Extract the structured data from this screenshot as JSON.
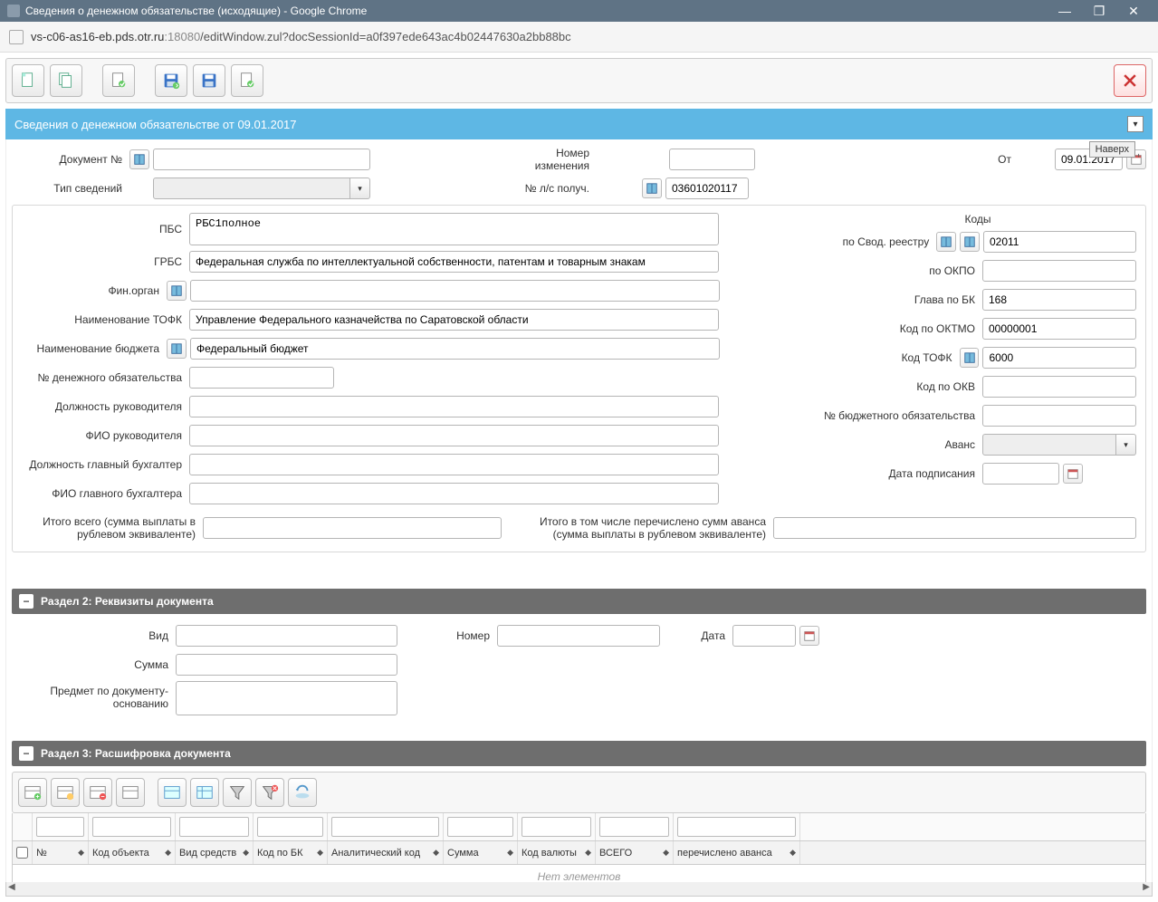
{
  "window": {
    "title": "Сведения о денежном обязательстве (исходящие) - Google Chrome",
    "minimize": "—",
    "maximize": "❐",
    "close": "✕"
  },
  "address": {
    "host": "vs-c06-as16-eb.pds.otr.ru",
    "port": ":18080",
    "path": "/editWindow.zul?docSessionId=a0f397ede643ac4b02447630a2bb88bc"
  },
  "header_title": "Сведения о денежном обязательстве от 09.01.2017",
  "naverh": "Наверх",
  "labels": {
    "doc_no": "Документ №",
    "tip_svedeniy": "Тип сведений",
    "nomer_izmeneniya": "Номер изменения",
    "ot": "От",
    "no_ls": "№ л/с получ.",
    "pbs": "ПБС",
    "grbs": "ГРБС",
    "fin_organ": "Фин.орган",
    "tofk_name": "Наименование ТОФК",
    "budget_name": "Наименование бюджета",
    "den_obyaz_no": "№ денежного обязательства",
    "ruk_dolzhnost": "Должность руководителя",
    "ruk_fio": "ФИО руководителя",
    "glav_buh_dolzhnost": "Должность главный бухгалтер",
    "glav_buh_fio": "ФИО главного бухгалтера",
    "kody": "Коды",
    "svod_reestr": "по Свод. реестру",
    "okpo": "по ОКПО",
    "glava_bk": "Глава по БК",
    "oktmo": "Код по ОКТМО",
    "kod_tofk": "Код ТОФК",
    "okv": "Код по ОКВ",
    "budzh_obyaz_no": "№ бюджетного обязательства",
    "avans": "Аванс",
    "data_podpis": "Дата подписания",
    "itogo_vsego": "Итого всего (сумма выплаты в рублевом эквиваленте)",
    "itogo_avansa": "Итого в том числе перечислено сумм аванса (сумма выплаты в рублевом эквиваленте)",
    "section2": "Раздел 2: Реквизиты документа",
    "vid": "Вид",
    "nomer": "Номер",
    "data": "Дата",
    "summa": "Сумма",
    "predmet": "Предмет по документу-основанию",
    "section3": "Раздел 3: Расшифровка документа"
  },
  "values": {
    "ot_date": "09.01.2017",
    "ls_no": "03601020117",
    "pbs": "РБС1полное",
    "grbs": "Федеральная служба по интеллектуальной собственности, патентам и товарным знакам",
    "tofk_name": "Управление Федерального казначейства по Саратовской области",
    "budget_name": "Федеральный бюджет",
    "svod_reestr": "02011",
    "glava_bk": "168",
    "oktmo": "00000001",
    "kod_tofk": "6000"
  },
  "grid": {
    "columns": [
      "№",
      "Код объекта",
      "Вид средств",
      "Код по БК",
      "Аналитический код",
      "Сумма",
      "Код валюты",
      "ВСЕГО",
      "перечислено аванса"
    ],
    "empty": "Нет элементов"
  }
}
